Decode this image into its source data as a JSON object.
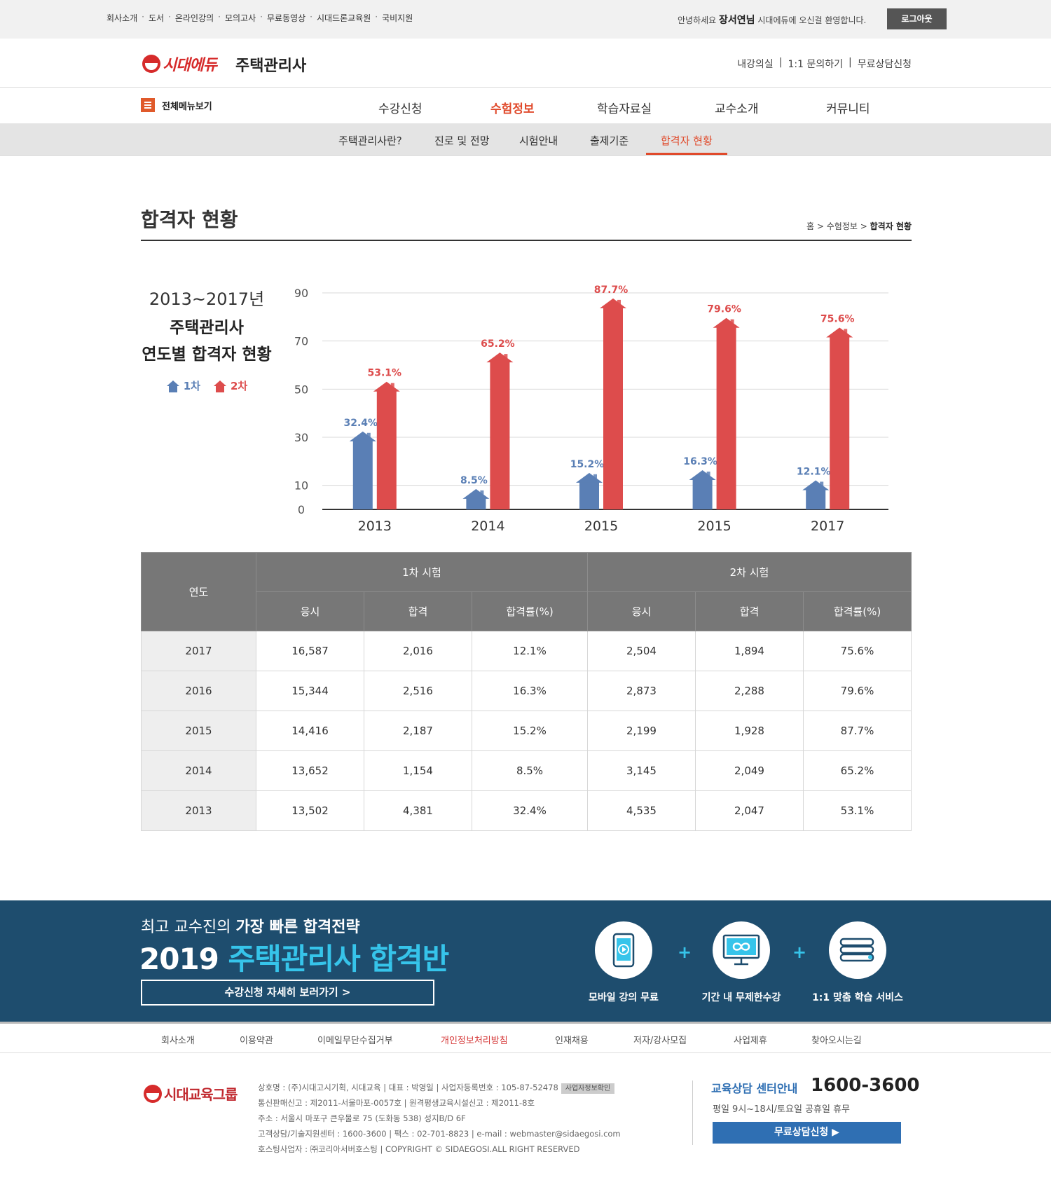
{
  "topbar": {
    "links": [
      "회사소개",
      "도서",
      "온라인강의",
      "모의고사",
      "무료동영상",
      "시대드론교육원",
      "국비지원"
    ],
    "greeting_prefix": "안녕하세요",
    "user_name": "장서연님",
    "greeting_suffix": "시대에듀에 오신걸 환영합니다.",
    "logout_label": "로그아웃"
  },
  "header": {
    "logo_text": "시대에듀",
    "site_name": "주택관리사",
    "links": [
      "내강의실",
      "1:1 문의하기",
      "무료상담신청"
    ]
  },
  "nav": {
    "all_menu_label": "전체메뉴보기",
    "items": [
      "수강신청",
      "수험정보",
      "학습자료실",
      "교수소개",
      "커뮤니티"
    ],
    "active_index": 1
  },
  "subnav": {
    "items": [
      "주택관리사란?",
      "진로 및 전망",
      "시험안내",
      "출제기준",
      "합격자 현황"
    ],
    "active_index": 4
  },
  "page": {
    "title": "합격자 현황",
    "breadcrumb": [
      "홈",
      "수험정보",
      "합격자 현황"
    ]
  },
  "chart_side": {
    "years": "2013~2017년",
    "heading1": "주택관리사",
    "heading2": "연도별 합격자 현황",
    "legend": [
      "1차",
      "2차"
    ]
  },
  "chart_data": {
    "type": "bar",
    "categories": [
      "2013",
      "2014",
      "2015",
      "2015",
      "2017"
    ],
    "series": [
      {
        "name": "1차",
        "values": [
          32.4,
          8.5,
          15.2,
          16.3,
          12.1
        ],
        "color": "#5a7fb5"
      },
      {
        "name": "2차",
        "values": [
          53.1,
          65.2,
          87.7,
          79.6,
          75.6
        ],
        "color": "#dd4c4c"
      }
    ],
    "data_labels": [
      [
        "32.4%",
        "8.5%",
        "15.2%",
        "16.3%",
        "12.1%"
      ],
      [
        "53.1%",
        "65.2%",
        "87.7%",
        "79.6%",
        "75.6%"
      ]
    ],
    "yticks": [
      0,
      10,
      30,
      50,
      70,
      90
    ],
    "ylim": [
      0,
      90
    ],
    "grid": true
  },
  "table": {
    "year_header": "연도",
    "group_headers": [
      "1차 시험",
      "2차 시험"
    ],
    "sub_headers": [
      "응시",
      "합격",
      "합격률(%)",
      "응시",
      "합격",
      "합격률(%)"
    ],
    "rows": [
      [
        "2017",
        "16,587",
        "2,016",
        "12.1%",
        "2,504",
        "1,894",
        "75.6%"
      ],
      [
        "2016",
        "15,344",
        "2,516",
        "16.3%",
        "2,873",
        "2,288",
        "79.6%"
      ],
      [
        "2015",
        "14,416",
        "2,187",
        "15.2%",
        "2,199",
        "1,928",
        "87.7%"
      ],
      [
        "2014",
        "13,652",
        "1,154",
        "8.5%",
        "3,145",
        "2,049",
        "65.2%"
      ],
      [
        "2013",
        "13,502",
        "4,381",
        "32.4%",
        "4,535",
        "2,047",
        "53.1%"
      ]
    ]
  },
  "banner": {
    "subtitle_prefix": "최고 교수진의",
    "subtitle_bold": "가장 빠른 합격전략",
    "main_prefix": "2019",
    "main_highlight": "주택관리사 합격반",
    "button_label": "수강신청 자세히 보러가기 >",
    "features": [
      "모바일 강의 무료",
      "기간 내 무제한수강",
      "1:1 맞춤 학습 서비스"
    ],
    "plus": "+"
  },
  "footer_nav": [
    "회사소개",
    "이용약관",
    "이메일무단수집거부",
    "개인정보처리방침",
    "인재채용",
    "저자/강사모집",
    "사업제휴",
    "찾아오시는길"
  ],
  "footer": {
    "logo_text": "시대교육그룹",
    "info_lines": [
      "상호명 : (주)시대고시기획, 시대교육 | 대표 : 박영일 | 사업자등록번호 : 105-87-52478",
      "통신판매신고 : 제2011-서울마포-0057호 | 원격평생교육시설신고 : 제2011-8호",
      "주소 : 서울시 마포구 큰우물로 75 (도화동 538) 성지B/D 6F",
      "고객상담/기술지원센터 : 1600-3600 | 팩스 : 02-701-8823 | e-mail : webmaster@sidaegosi.com",
      "호스팅사업자 : ㈜코리아서버호스팅 | COPYRIGHT © SIDAEGOSI.ALL RIGHT RESERVED"
    ],
    "badge": "사업자정보확인",
    "call_title": "교육상담 센터안내",
    "call_number": "1600-3600",
    "call_hours": "평일 9시~18시/토요일 공휴일 휴무",
    "call_button": "무료상담신청 ▶"
  }
}
